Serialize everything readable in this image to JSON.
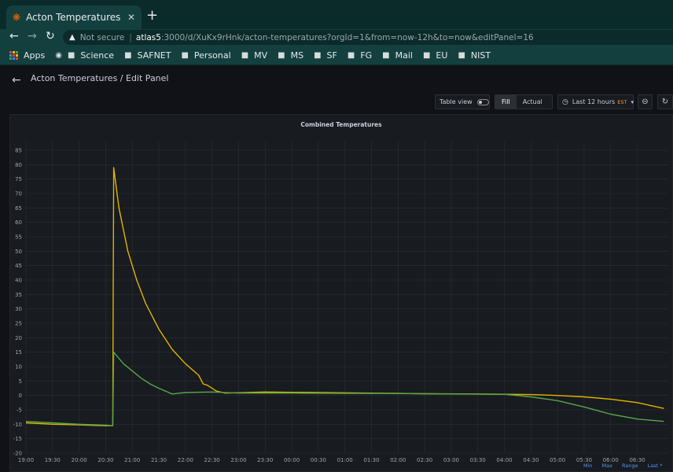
{
  "browser": {
    "tab_title": "Acton Temperatures - Gra",
    "new_tab": "+",
    "security_label": "Not secure",
    "url_host": "atlas5",
    "url_rest": ":3000/d/XuKx9rHnk/acton-temperatures?orgId=1&from=now-12h&to=now&editPanel=16"
  },
  "bookmarks": [
    "Apps",
    "Science",
    "SAFNET",
    "Personal",
    "MV",
    "MS",
    "SF",
    "FG",
    "Mail",
    "EU",
    "NIST"
  ],
  "header": {
    "title": "Acton Temperatures / Edit Panel"
  },
  "toolbar": {
    "table_view": "Table view",
    "fill": "Fill",
    "actual": "Actual",
    "time_range": "Last 12 hours",
    "timezone": "EST"
  },
  "panel": {
    "legend": [
      "Min",
      "Max",
      "Range",
      "Last *"
    ]
  },
  "colors": {
    "yellow": "#e0b400",
    "green": "#56a64b",
    "grid": "#2c3035",
    "text": "#9fa4ab"
  },
  "chart_data": {
    "type": "line",
    "title": "Combined Temperatures",
    "ylim": [
      -20,
      88
    ],
    "yticks": [
      -20,
      -15,
      -10,
      -5,
      0,
      5,
      10,
      15,
      20,
      25,
      30,
      35,
      40,
      45,
      50,
      55,
      60,
      65,
      70,
      75,
      80,
      85
    ],
    "xlim": [
      "19:00",
      "07:05"
    ],
    "xticks": [
      "19:00",
      "19:30",
      "20:00",
      "20:30",
      "21:00",
      "21:30",
      "22:00",
      "22:30",
      "23:00",
      "23:30",
      "00:00",
      "00:30",
      "01:00",
      "01:30",
      "02:00",
      "02:30",
      "03:00",
      "03:30",
      "04:00",
      "04:30",
      "05:00",
      "05:30",
      "06:00",
      "06:30"
    ],
    "grid": true,
    "series": [
      {
        "color": "#e0b400",
        "points": [
          [
            "19:00",
            -9.5
          ],
          [
            "19:30",
            -10
          ],
          [
            "20:00",
            -10.2
          ],
          [
            "20:30",
            -10.5
          ],
          [
            "20:38",
            -10.5
          ],
          [
            "20:39",
            79
          ],
          [
            "20:45",
            65
          ],
          [
            "20:55",
            50
          ],
          [
            "21:05",
            40
          ],
          [
            "21:15",
            32
          ],
          [
            "21:30",
            23
          ],
          [
            "21:45",
            16
          ],
          [
            "22:00",
            11
          ],
          [
            "22:15",
            7
          ],
          [
            "22:20",
            4
          ],
          [
            "22:25",
            3.5
          ],
          [
            "22:35",
            1.5
          ],
          [
            "22:45",
            0.8
          ],
          [
            "23:30",
            1.2
          ],
          [
            "00:30",
            1.0
          ],
          [
            "01:30",
            0.8
          ],
          [
            "02:30",
            0.6
          ],
          [
            "03:30",
            0.5
          ],
          [
            "04:30",
            0.3
          ],
          [
            "05:00",
            0
          ],
          [
            "05:30",
            -0.5
          ],
          [
            "06:00",
            -1.3
          ],
          [
            "06:30",
            -2.5
          ],
          [
            "07:00",
            -4.5
          ]
        ]
      },
      {
        "color": "#56a64b",
        "points": [
          [
            "19:00",
            -9
          ],
          [
            "19:30",
            -9.5
          ],
          [
            "20:00",
            -10
          ],
          [
            "20:30",
            -10.3
          ],
          [
            "20:38",
            -10.5
          ],
          [
            "20:39",
            15
          ],
          [
            "20:50",
            11
          ],
          [
            "21:10",
            6
          ],
          [
            "21:20",
            4
          ],
          [
            "21:30",
            2.5
          ],
          [
            "21:45",
            0.5
          ],
          [
            "22:00",
            1
          ],
          [
            "22:30",
            1.2
          ],
          [
            "23:00",
            0.8
          ],
          [
            "00:00",
            0.8
          ],
          [
            "01:00",
            0.7
          ],
          [
            "02:00",
            0.7
          ],
          [
            "03:00",
            0.5
          ],
          [
            "04:00",
            0.4
          ],
          [
            "04:30",
            -0.5
          ],
          [
            "05:00",
            -1.8
          ],
          [
            "05:30",
            -4
          ],
          [
            "06:00",
            -6.5
          ],
          [
            "06:30",
            -8.2
          ],
          [
            "07:00",
            -9
          ]
        ]
      }
    ]
  }
}
